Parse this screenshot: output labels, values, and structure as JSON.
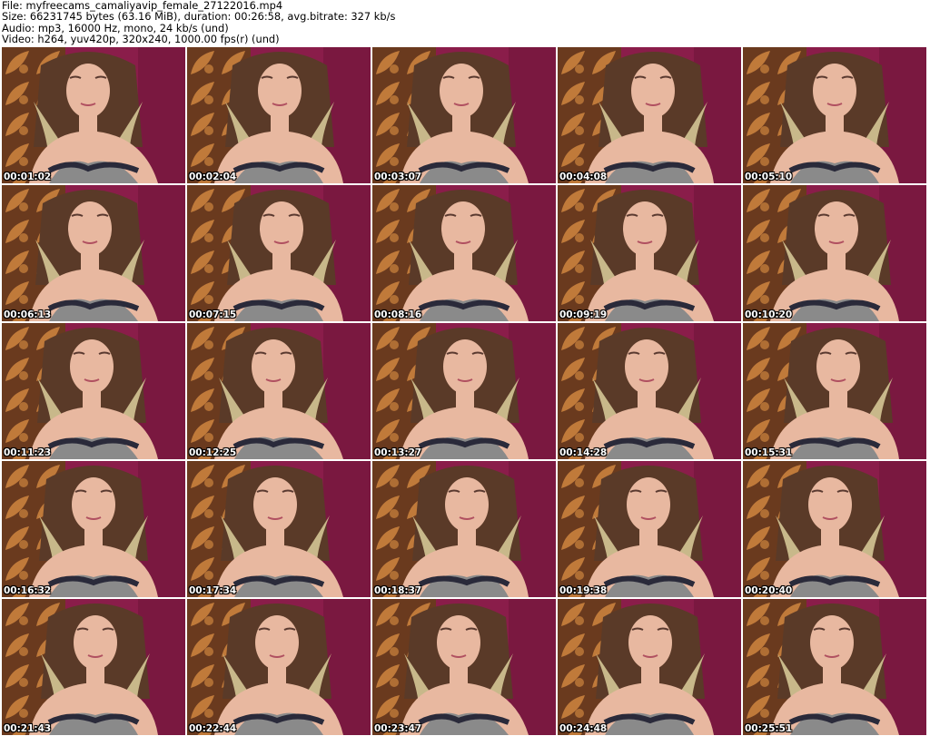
{
  "header": {
    "file_line": "File: myfreecams_camaliyavip_female_27122016.mp4",
    "size_line": "Size: 66231745 bytes (63.16 MiB), duration: 00:26:58, avg.bitrate: 327 kb/s",
    "audio_line": "Audio: mp3, 16000 Hz, mono, 24 kb/s (und)",
    "video_line": "Video: h264, yuv420p, 320x240, 1000.00 fps(r) (und)"
  },
  "thumbnails": [
    {
      "timestamp": "00:01:02"
    },
    {
      "timestamp": "00:02:04"
    },
    {
      "timestamp": "00:03:07"
    },
    {
      "timestamp": "00:04:08"
    },
    {
      "timestamp": "00:05:10"
    },
    {
      "timestamp": "00:06:13"
    },
    {
      "timestamp": "00:07:15"
    },
    {
      "timestamp": "00:08:16"
    },
    {
      "timestamp": "00:09:19"
    },
    {
      "timestamp": "00:10:20"
    },
    {
      "timestamp": "00:11:23"
    },
    {
      "timestamp": "00:12:25"
    },
    {
      "timestamp": "00:13:27"
    },
    {
      "timestamp": "00:14:28"
    },
    {
      "timestamp": "00:15:31"
    },
    {
      "timestamp": "00:16:32"
    },
    {
      "timestamp": "00:17:34"
    },
    {
      "timestamp": "00:18:37"
    },
    {
      "timestamp": "00:19:38"
    },
    {
      "timestamp": "00:20:40"
    },
    {
      "timestamp": "00:21:43"
    },
    {
      "timestamp": "00:22:44"
    },
    {
      "timestamp": "00:23:47"
    },
    {
      "timestamp": "00:24:48"
    },
    {
      "timestamp": "00:25:51"
    }
  ],
  "colors": {
    "backdrop_magenta": "#8a1d4a",
    "curtain_brown": "#6a3a1e",
    "curtain_orange": "#c07a3a",
    "skin": "#e8b8a0",
    "hair_blonde": "#c8b88a",
    "hair_dark": "#5a3a28",
    "bra_gray": "#8a8a8a",
    "bra_lace": "#2a2a3a"
  }
}
